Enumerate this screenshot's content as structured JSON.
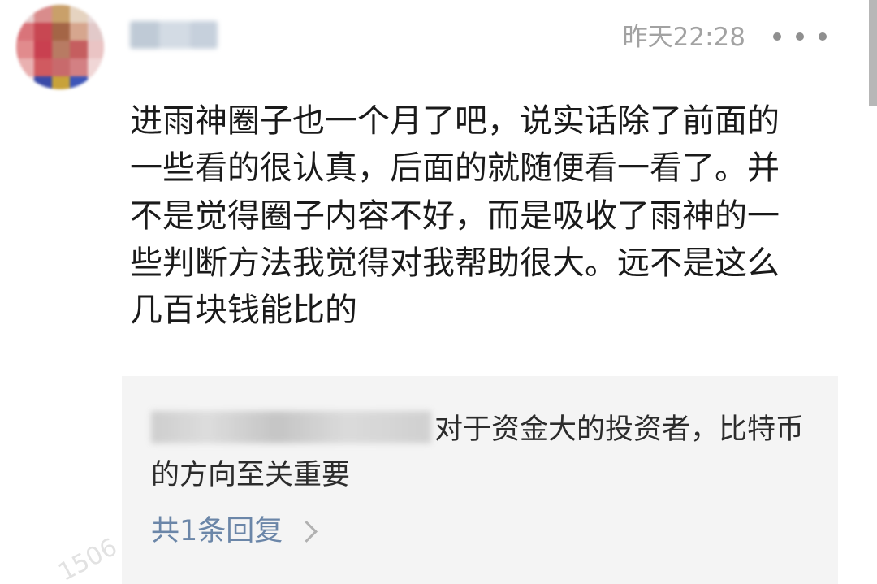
{
  "comment": {
    "timestamp": "昨天22:28",
    "body": "进雨神圈子也一个月了吧，说实话除了前面的一些看的很认真，后面的就随便看一看了。并不是觉得圈子内容不好，而是吸收了雨神的一些判断方法我觉得对我帮助很大。远不是这么几百块钱能比的"
  },
  "reply": {
    "text": "对于资金大的投资者，比特币的方向至关重要",
    "count_label": "共1条回复"
  },
  "watermark": "1506",
  "icons": {
    "more": "more-dots-icon",
    "chevron": "chevron-right-icon"
  },
  "colors": {
    "link": "#6b86a8",
    "timestamp": "#a2a2a2",
    "reply_bg": "#f4f4f4"
  }
}
